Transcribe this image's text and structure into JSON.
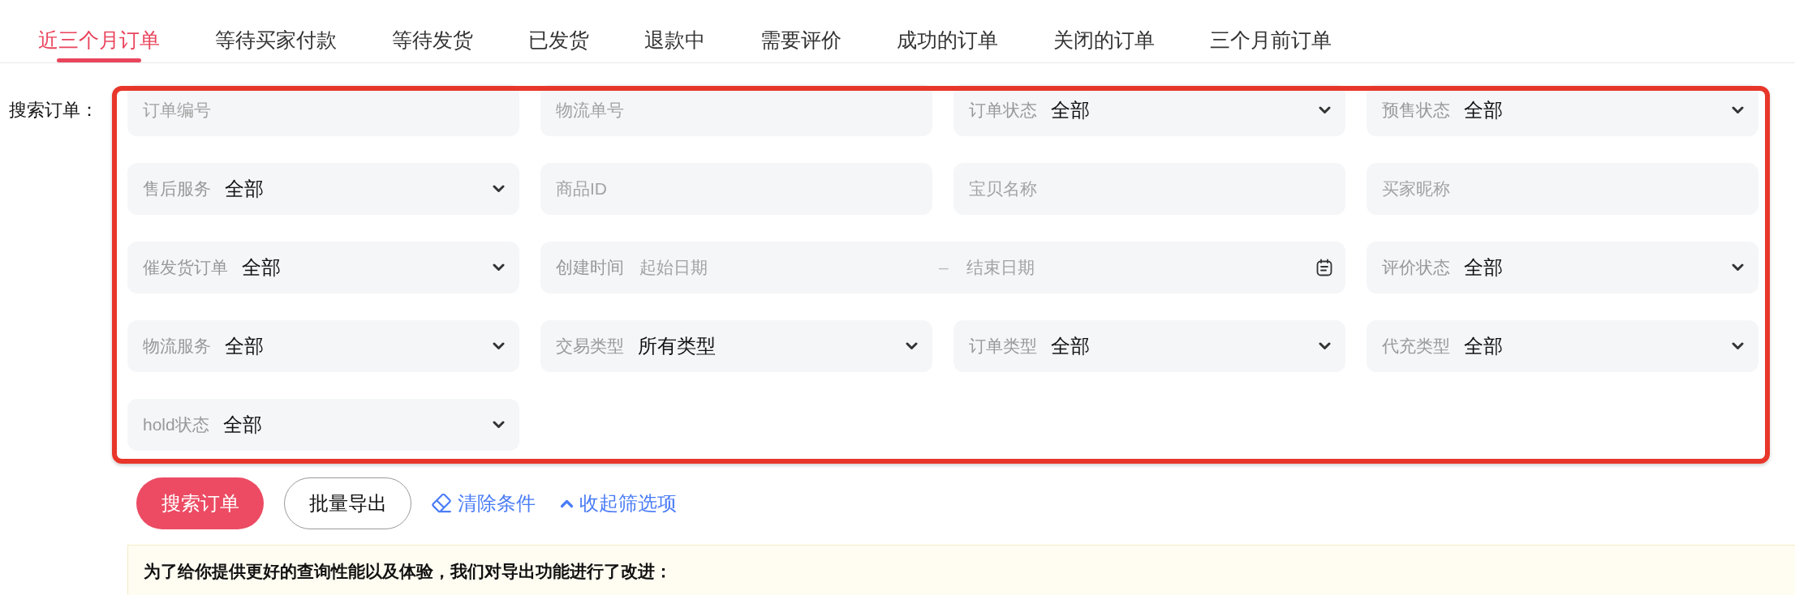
{
  "tabs": [
    {
      "label": "近三个月订单",
      "selected": true
    },
    {
      "label": "等待买家付款",
      "selected": false
    },
    {
      "label": "等待发货",
      "selected": false
    },
    {
      "label": "已发货",
      "selected": false
    },
    {
      "label": "退款中",
      "selected": false
    },
    {
      "label": "需要评价",
      "selected": false
    },
    {
      "label": "成功的订单",
      "selected": false
    },
    {
      "label": "关闭的订单",
      "selected": false
    },
    {
      "label": "三个月前订单",
      "selected": false
    }
  ],
  "search": {
    "label": "搜索订单：",
    "fields": [
      {
        "kind": "text",
        "placeholder": "订单编号"
      },
      {
        "kind": "text",
        "placeholder": "物流单号"
      },
      {
        "kind": "select",
        "label": "订单状态",
        "value": "全部"
      },
      {
        "kind": "select",
        "label": "预售状态",
        "value": "全部"
      },
      {
        "kind": "select",
        "label": "售后服务",
        "value": "全部"
      },
      {
        "kind": "text",
        "placeholder": "商品ID"
      },
      {
        "kind": "text",
        "placeholder": "宝贝名称"
      },
      {
        "kind": "text",
        "placeholder": "买家昵称"
      },
      {
        "kind": "select",
        "label": "催发货订单",
        "value": "全部"
      },
      {
        "kind": "date_range",
        "label": "创建时间",
        "start_placeholder": "起始日期",
        "separator": "–",
        "end_placeholder": "结束日期"
      },
      {
        "kind": "select",
        "label": "评价状态",
        "value": "全部"
      },
      {
        "kind": "select",
        "label": "物流服务",
        "value": "全部"
      },
      {
        "kind": "select",
        "label": "交易类型",
        "value": "所有类型"
      },
      {
        "kind": "select",
        "label": "订单类型",
        "value": "全部"
      },
      {
        "kind": "select",
        "label": "代充类型",
        "value": "全部"
      },
      {
        "kind": "select",
        "label": "hold状态",
        "value": "全部"
      }
    ]
  },
  "actions": [
    {
      "kind": "primary",
      "label": "搜索订单"
    },
    {
      "kind": "secondary",
      "label": "批量导出"
    },
    {
      "kind": "clear",
      "label": "清除条件"
    },
    {
      "kind": "collapse",
      "label": "收起筛选项"
    }
  ],
  "notice": {
    "text": "为了给你提供更好的查询性能以及体验，我们对导出功能进行了改进："
  }
}
